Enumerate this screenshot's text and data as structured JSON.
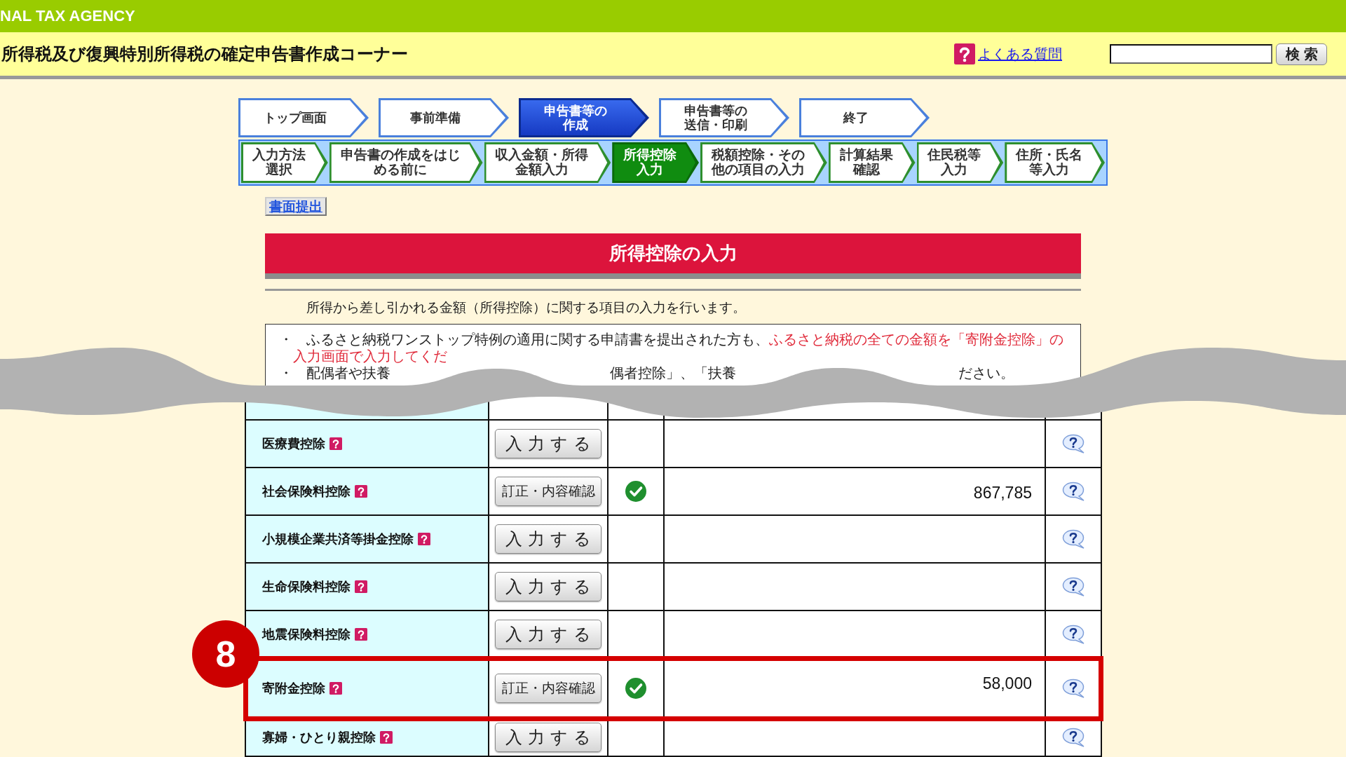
{
  "agency_bar": {
    "title": "NAL TAX AGENCY"
  },
  "header": {
    "title": "所得税及び復興特別所得税の確定申告書作成コーナー",
    "faq_link": "よくある質問",
    "search_button": "検索"
  },
  "main_steps": [
    {
      "label": "トップ画面",
      "selected": false
    },
    {
      "label": "事前準備",
      "selected": false
    },
    {
      "label": "申告書等の作成",
      "selected": true
    },
    {
      "label": "申告書等の送信・印刷",
      "selected": false
    },
    {
      "label": "終了",
      "selected": false
    }
  ],
  "sub_steps": [
    {
      "label": "入力方法選択",
      "selected": false
    },
    {
      "label": "申告書の作成をはじめる前に",
      "selected": false
    },
    {
      "label": "収入金額・所得金額入力",
      "selected": false
    },
    {
      "label": "所得控除入力",
      "selected": true
    },
    {
      "label": "税額控除・その他の項目の入力",
      "selected": false
    },
    {
      "label": "計算結果確認",
      "selected": false
    },
    {
      "label": "住民税等入力",
      "selected": false
    },
    {
      "label": "住所・氏名等入力",
      "selected": false
    }
  ],
  "paper_filing_link": "書面提出",
  "page_title": "所得控除の入力",
  "intro": "所得から差し引かれる金額（所得控除）に関する項目の入力を行います。",
  "notice": [
    {
      "kind": "sentence",
      "bullet": "・",
      "segments": [
        {
          "text": "ふるさと納税ワンストップ特例の適用に関する申請書を提出された方も、",
          "highlight": false
        },
        {
          "text": "ふるさと納税の全ての金額を「寄附金控除」の入力画面で入力してくだ",
          "highlight": true
        }
      ]
    },
    {
      "kind": "fragments",
      "bullet": "・",
      "fragments": [
        "配偶者や扶養",
        "偶者控除」、「扶養",
        "ださい。"
      ]
    }
  ],
  "deductions": [
    {
      "kind": "partial",
      "highlighted": false
    },
    {
      "kind": "standard",
      "label": "医療費控除",
      "button": "入力する",
      "done": false,
      "highlighted": false
    },
    {
      "kind": "standard",
      "label": "社会保険料控除",
      "button": "訂正・内容確認",
      "done": true,
      "amount": "867,785",
      "highlighted": false
    },
    {
      "kind": "standard",
      "label": "小規模企業共済等掛金控除",
      "button": "入力する",
      "done": false,
      "highlighted": false
    },
    {
      "kind": "standard",
      "label": "生命保険料控除",
      "button": "入力する",
      "done": false,
      "highlighted": false
    },
    {
      "kind": "standard",
      "label": "地震保険料控除",
      "button": "入力する",
      "done": false,
      "highlighted": false
    },
    {
      "kind": "tall",
      "label": "寄附金控除",
      "button": "訂正・内容確認",
      "done": true,
      "amount": "58,000",
      "highlighted": true,
      "callout": "8"
    },
    {
      "kind": "last",
      "label": "寡婦・ひとり親控除",
      "button": "入力する",
      "done": false,
      "highlighted": false
    }
  ]
}
